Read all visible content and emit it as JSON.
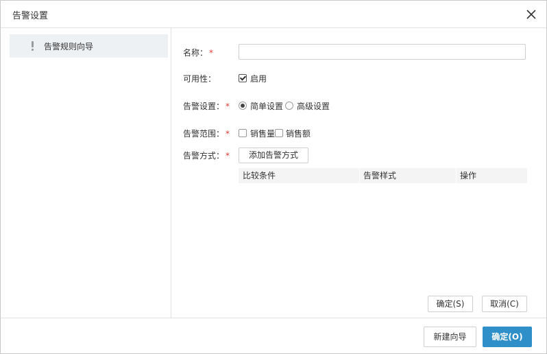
{
  "dialog": {
    "title": "告警设置",
    "close_icon": "close-icon"
  },
  "sidebar": {
    "items": [
      {
        "label": "告警规则向导",
        "icon": "exclamation-icon"
      }
    ]
  },
  "form": {
    "name": {
      "label": "名称：",
      "required_mark": "*",
      "value": "",
      "placeholder": ""
    },
    "availability": {
      "label": "可用性：",
      "option_label": "启用",
      "checked": true
    },
    "alert_setting": {
      "label": "告警设置：",
      "required_mark": "*",
      "options": [
        {
          "label": "简单设置",
          "selected": true
        },
        {
          "label": "高级设置",
          "selected": false
        }
      ]
    },
    "alert_scope": {
      "label": "告警范围：",
      "required_mark": "*",
      "options": [
        {
          "label": "销售量",
          "checked": false
        },
        {
          "label": "销售额",
          "checked": false
        }
      ]
    },
    "alert_method": {
      "label": "告警方式：",
      "required_mark": "*",
      "add_button": "添加告警方式"
    }
  },
  "table": {
    "columns": [
      "比较条件",
      "告警样式",
      "操作"
    ],
    "rows": []
  },
  "panel_actions": {
    "ok_label": "确定(S)",
    "cancel_label": "取消(C)"
  },
  "footer": {
    "new_wizard_label": "新建向导",
    "ok_label": "确定(O)"
  },
  "colors": {
    "primary": "#2f8fc8",
    "required": "#e23b3b",
    "sidebar_selected_bg": "#eef1f4",
    "table_header_bg": "#f4f4f4"
  }
}
